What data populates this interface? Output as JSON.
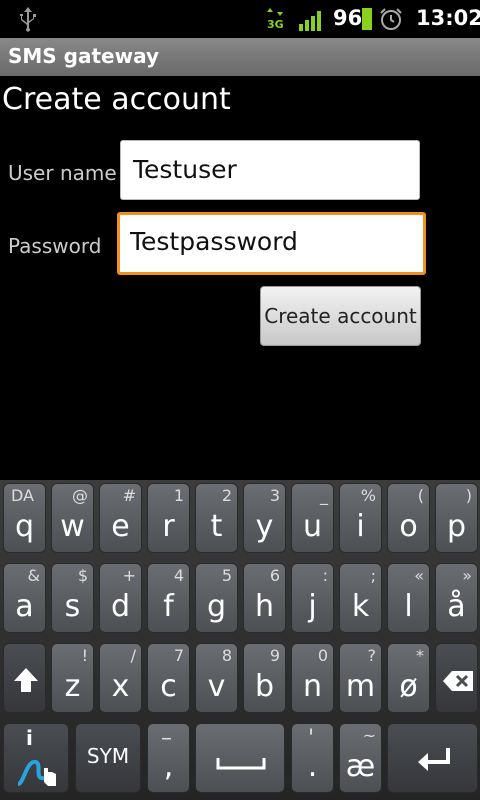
{
  "status_bar": {
    "battery_percent": "96",
    "time": "13:02",
    "network_type": "3G",
    "icons": [
      "usb-icon",
      "3g-data-icon",
      "signal-icon",
      "battery-icon",
      "alarm-icon"
    ]
  },
  "app_title": "SMS gateway",
  "page_heading": "Create account",
  "form": {
    "username_label": "User name",
    "username_value": "Testuser",
    "password_label": "Password",
    "password_value": "Testpassword",
    "submit_label": "Create account"
  },
  "keyboard": {
    "row1": [
      {
        "key": "q",
        "sec": "DA"
      },
      {
        "key": "w",
        "sec": "@"
      },
      {
        "key": "e",
        "sec": "#"
      },
      {
        "key": "r",
        "sec": "1"
      },
      {
        "key": "t",
        "sec": "2"
      },
      {
        "key": "y",
        "sec": "3"
      },
      {
        "key": "u",
        "sec": "_"
      },
      {
        "key": "i",
        "sec": "%"
      },
      {
        "key": "o",
        "sec": "("
      },
      {
        "key": "p",
        "sec": ")"
      }
    ],
    "row2": [
      {
        "key": "a",
        "sec": "&"
      },
      {
        "key": "s",
        "sec": "$"
      },
      {
        "key": "d",
        "sec": "+"
      },
      {
        "key": "f",
        "sec": "4"
      },
      {
        "key": "g",
        "sec": "5"
      },
      {
        "key": "h",
        "sec": "6"
      },
      {
        "key": "j",
        "sec": ":"
      },
      {
        "key": "k",
        "sec": ";"
      },
      {
        "key": "l",
        "sec": "«"
      },
      {
        "key": "å",
        "sec": "»"
      }
    ],
    "row3": [
      {
        "key": "z",
        "sec": "!"
      },
      {
        "key": "x",
        "sec": "/"
      },
      {
        "key": "c",
        "sec": "7"
      },
      {
        "key": "v",
        "sec": "8"
      },
      {
        "key": "b",
        "sec": "9"
      },
      {
        "key": "n",
        "sec": "0"
      },
      {
        "key": "m",
        "sec": "?"
      },
      {
        "key": "ø",
        "sec": "*"
      }
    ],
    "sym_label": "SYM",
    "comma_key": ",",
    "comma_sec": "–",
    "period_key": ".",
    "period_sec": "'",
    "ae_key": "æ",
    "ae_sec": "~",
    "info_sec": "i"
  },
  "colors": {
    "focus_border": "#f09020",
    "titlebar": "#7a7a7a",
    "signal_green": "#8ad11e"
  }
}
